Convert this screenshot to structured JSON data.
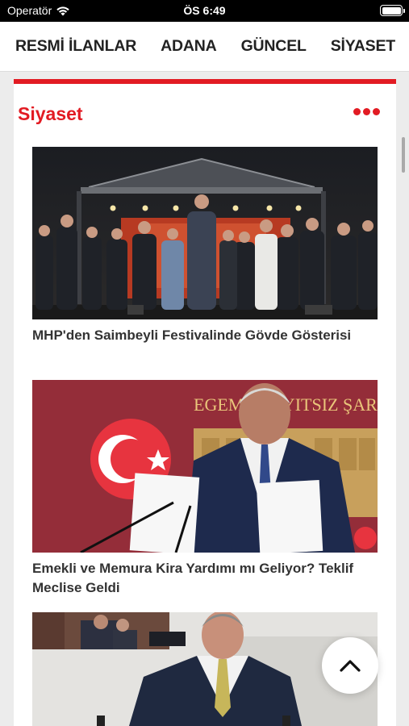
{
  "status_bar": {
    "carrier": "Operatör",
    "time": "ÖS 6:49"
  },
  "categories": [
    {
      "label": "RESMİ İLANLAR"
    },
    {
      "label": "ADANA"
    },
    {
      "label": "GÜNCEL"
    },
    {
      "label": "SİYASET"
    }
  ],
  "section": {
    "title": "Siyaset",
    "accent_color": "#e21b23",
    "menu_icon": "more-dots-icon"
  },
  "articles": [
    {
      "headline": "MHP'den Saimbeyli Festivalinde Gövde Gösterisi"
    },
    {
      "headline": "Emekli ve Memura Kira Yardımı mı Geliyor? Teklif Meclise Geldi"
    },
    {
      "headline": ""
    }
  ],
  "photo_text": {
    "banner": "EGEMEN      AYITSIZ ŞAR"
  },
  "scroll_top": {
    "icon": "chevron-up-icon"
  }
}
